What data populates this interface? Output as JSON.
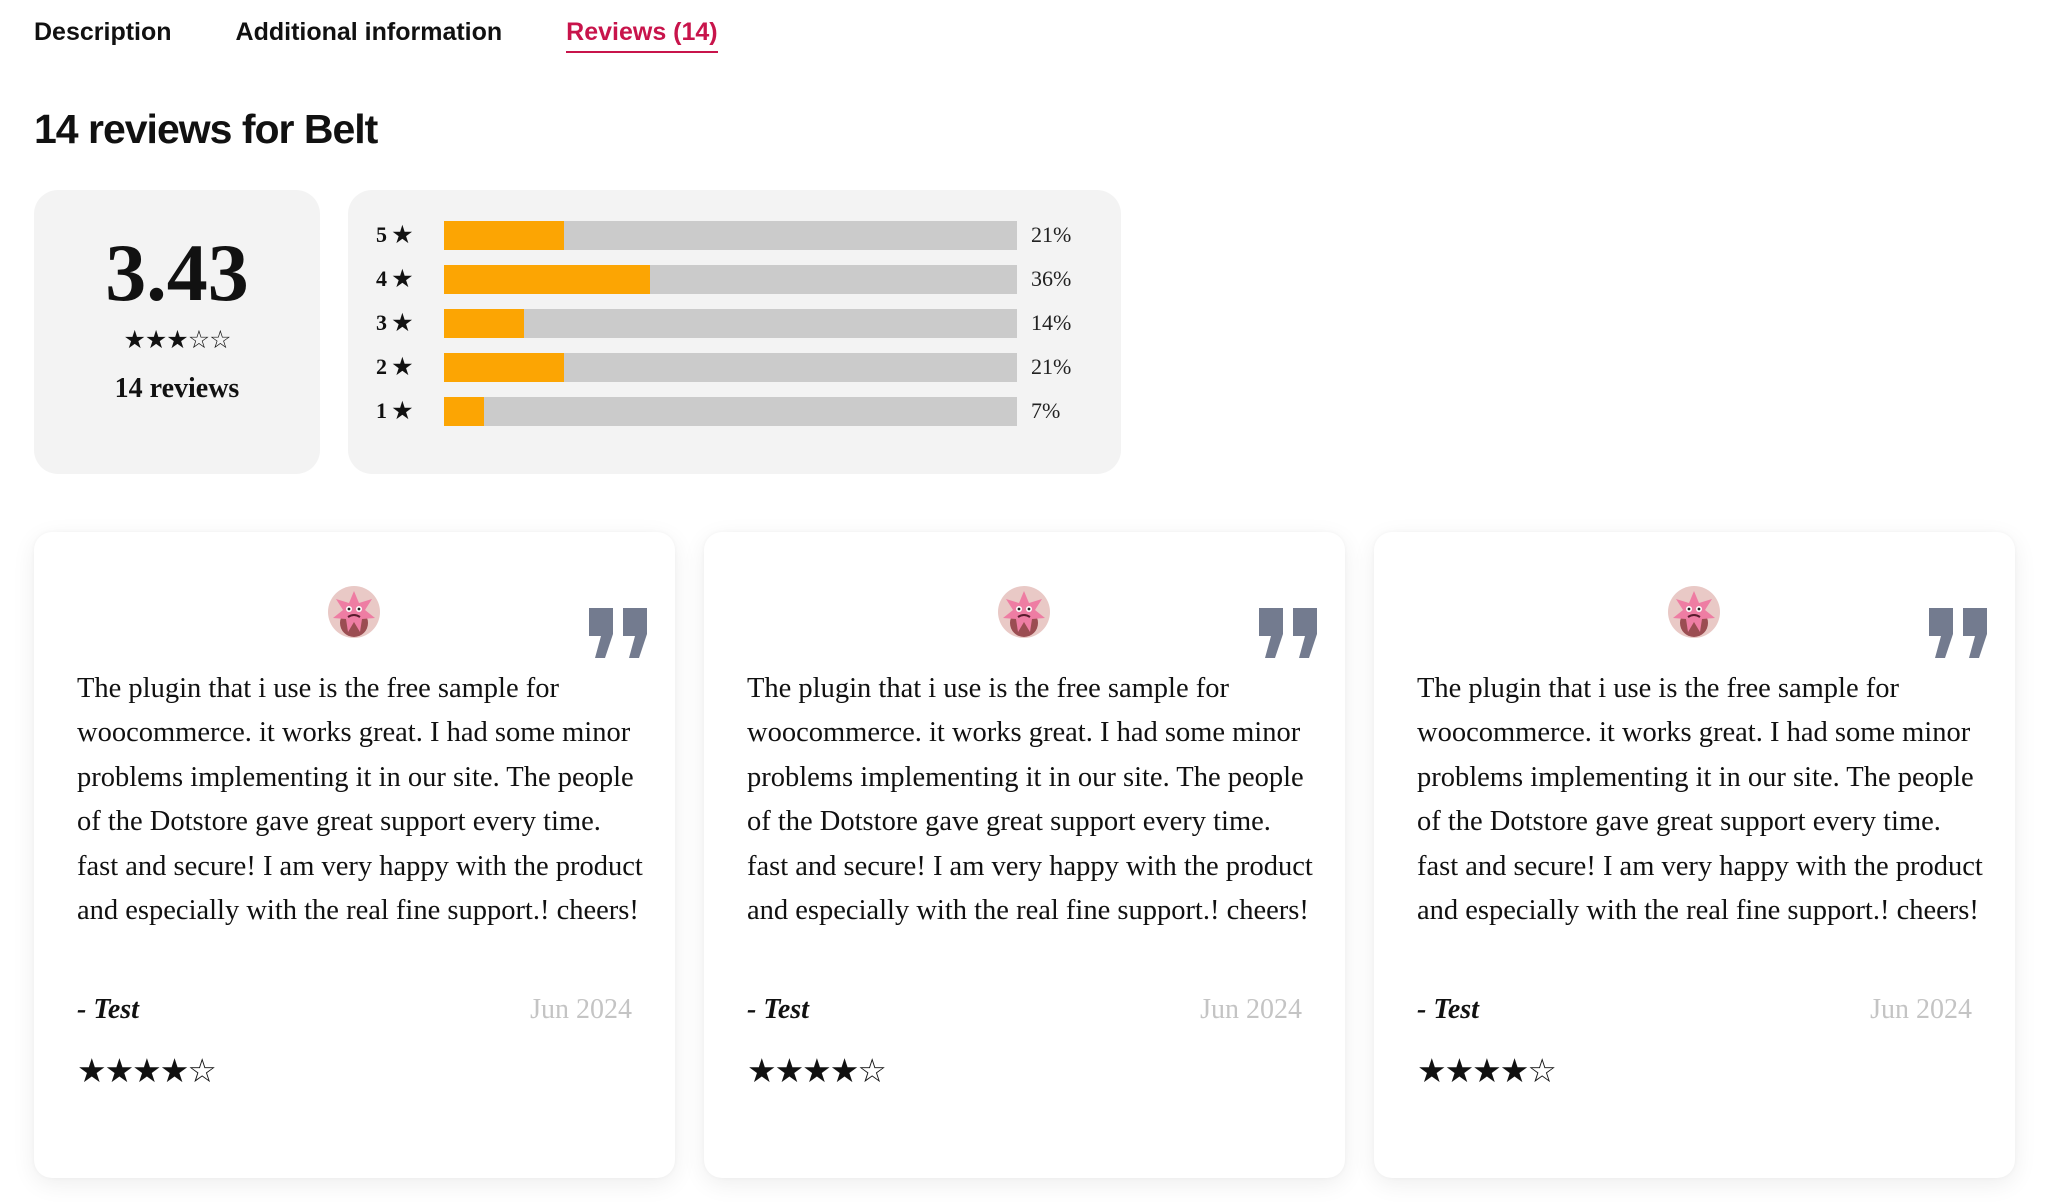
{
  "tabs": [
    {
      "label": "Description",
      "active": false
    },
    {
      "label": "Additional information",
      "active": false
    },
    {
      "label": "Reviews (14)",
      "active": true
    }
  ],
  "heading": "14 reviews for Belt",
  "summary": {
    "average": "3.43",
    "average_value": 3.43,
    "stars": "★★★☆☆",
    "review_count": "14 reviews"
  },
  "distribution": [
    {
      "label": "5 ★",
      "fraction": 0.21,
      "percent": "21%"
    },
    {
      "label": "4 ★",
      "fraction": 0.36,
      "percent": "36%"
    },
    {
      "label": "3 ★",
      "fraction": 0.14,
      "percent": "14%"
    },
    {
      "label": "2 ★",
      "fraction": 0.21,
      "percent": "21%"
    },
    {
      "label": "1 ★",
      "fraction": 0.07,
      "percent": "7%"
    }
  ],
  "reviews": [
    {
      "text": "The plugin that i use is the free sample for woocommerce. it works great. I had some minor problems implementing it in our site. The people of the Dotstore gave great support every time. fast and secure! I am very happy with the product and especially with the real fine support.! cheers!",
      "author": "- Test",
      "date": "Jun 2024",
      "rating": 4,
      "stars": "★★★★☆"
    },
    {
      "text": "The plugin that i use is the free sample for woocommerce. it works great. I had some minor problems implementing it in our site. The people of the Dotstore gave great support every time. fast and secure! I am very happy with the product and especially with the real fine support.! cheers!",
      "author": "- Test",
      "date": "Jun 2024",
      "rating": 4,
      "stars": "★★★★☆"
    },
    {
      "text": "The plugin that i use is the free sample for woocommerce. it works great. I had some minor problems implementing it in our site. The people of the Dotstore gave great support every time. fast and secure! I am very happy with the product and especially with the real fine support.! cheers!",
      "author": "- Test",
      "date": "Jun 2024",
      "rating": 4,
      "stars": "★★★★☆"
    }
  ],
  "colors": {
    "accent": "#c8144b",
    "bar_fill": "#fca503",
    "bar_track": "#cbcbcb",
    "quote_mark": "#737b8f",
    "panel_bg": "#f3f3f3"
  },
  "icons": {
    "quote": "closing-quote-icon",
    "avatar": "pink-star-avatar"
  }
}
